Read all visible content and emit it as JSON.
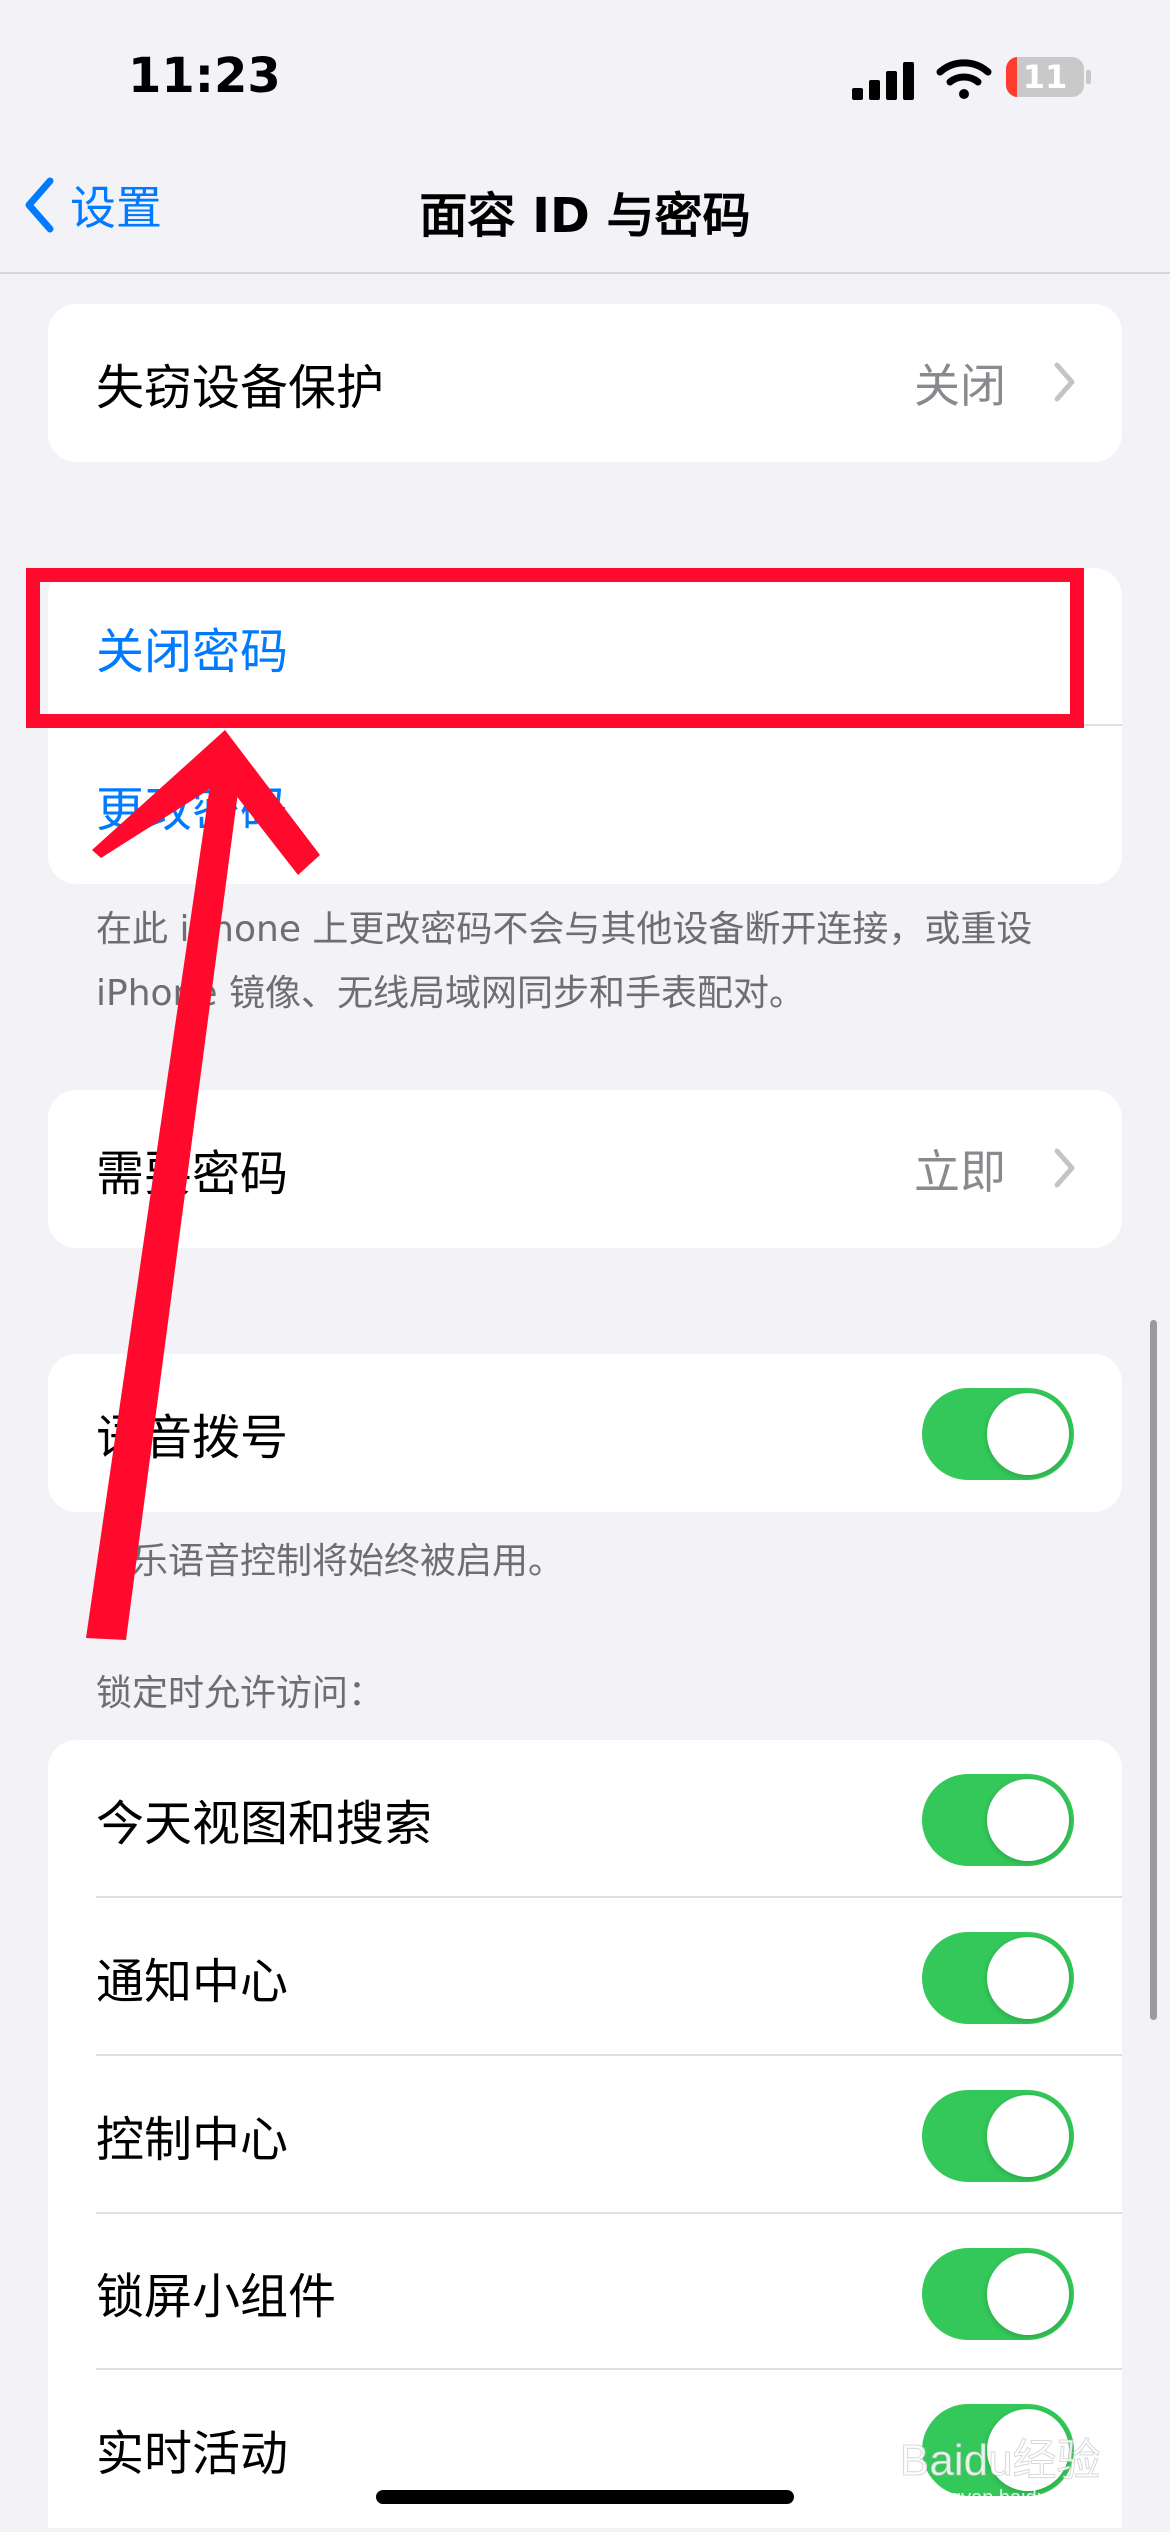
{
  "status_bar": {
    "time": "11:23",
    "battery_level": "11"
  },
  "nav": {
    "back_label": "设置",
    "title": "面容 ID 与密码"
  },
  "stolen_device": {
    "label": "失窃设备保护",
    "value": "关闭"
  },
  "passcode_group": {
    "turn_off_label": "关闭密码",
    "change_label": "更改密码",
    "footnote": "在此 iPhone 上更改密码不会与其他设备断开连接，或重设 iPhone 镜像、无线局域网同步和手表配对。"
  },
  "require_passcode": {
    "label": "需要密码",
    "value": "立即"
  },
  "voice_dial": {
    "label": "语音拨号",
    "on": true,
    "footnote": "音乐语音控制将始终被启用。"
  },
  "locked_access": {
    "header": "锁定时允许访问：",
    "items": [
      {
        "label": "今天视图和搜索",
        "on": true
      },
      {
        "label": "通知中心",
        "on": true
      },
      {
        "label": "控制中心",
        "on": true
      },
      {
        "label": "锁屏小组件",
        "on": true
      },
      {
        "label": "实时活动",
        "on": true
      }
    ]
  },
  "watermark_text": "Baidu 经验 jingyan.baidu.com",
  "colors": {
    "accent": "#007aff",
    "toggle_on": "#34c759",
    "annotation": "#ff0a2c"
  },
  "icons": [
    "signal-icon",
    "wifi-icon",
    "battery-icon",
    "back-chevron-icon",
    "chevron-right-icon",
    "annotation-arrow"
  ]
}
